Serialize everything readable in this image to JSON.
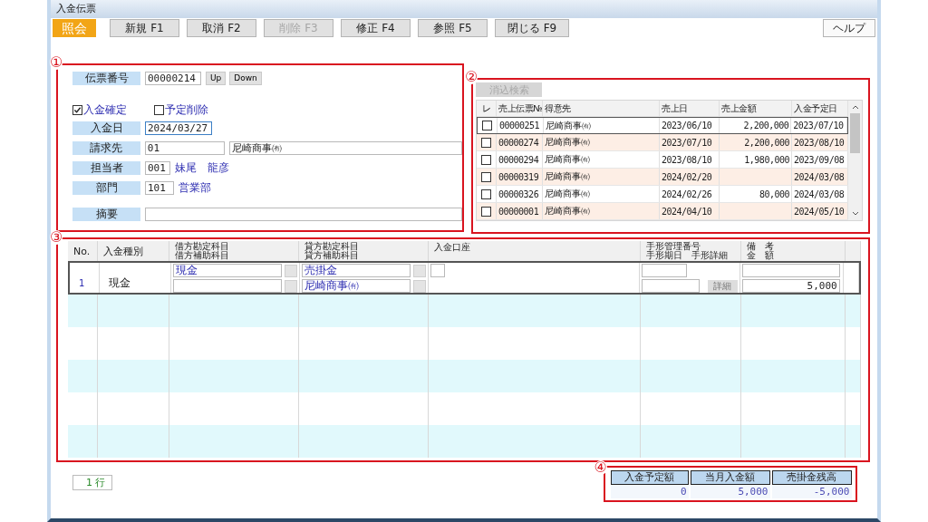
{
  "window": {
    "title": "入金伝票"
  },
  "mode_badge": "照会",
  "toolbar": [
    {
      "label": "新規 F1",
      "disabled": false
    },
    {
      "label": "取消 F2",
      "disabled": false
    },
    {
      "label": "削除 F3",
      "disabled": true
    },
    {
      "label": "修正 F4",
      "disabled": false
    },
    {
      "label": "参照 F5",
      "disabled": false
    },
    {
      "label": "閉じる F9",
      "disabled": false
    }
  ],
  "help_button": "ヘルプ",
  "header_form": {
    "marker": "①",
    "slip_no": {
      "label": "伝票番号",
      "value": "00000214"
    },
    "nav_buttons": [
      "Up",
      "Down"
    ],
    "checks": [
      {
        "label": "入金確定",
        "checked": true
      },
      {
        "label": "予定削除",
        "checked": false
      }
    ],
    "date": {
      "label": "入金日",
      "value": "2024/03/27"
    },
    "billing": {
      "label": "請求先",
      "code": "01",
      "name": "尼崎商事㈲"
    },
    "staff": {
      "label": "担当者",
      "code": "001",
      "name": "妹尾　龍彦"
    },
    "dept": {
      "label": "部門",
      "code": "101",
      "name": "営業部"
    },
    "memo": {
      "label": "摘要"
    }
  },
  "sales_list": {
    "marker": "②",
    "search_button": {
      "label": "消込検索",
      "disabled": true
    },
    "check_header": "レ",
    "columns": [
      "売上伝票№",
      "得意先",
      "売上日",
      "売上金額",
      "入金予定日"
    ],
    "rows": [
      {
        "checked": false,
        "selected": true,
        "cells": [
          "00000251",
          "尼崎商事㈲",
          "2023/06/10",
          "2,200,000",
          "2023/07/10"
        ]
      },
      {
        "checked": false,
        "selected": false,
        "cells": [
          "00000274",
          "尼崎商事㈲",
          "2023/07/10",
          "2,200,000",
          "2023/08/10"
        ]
      },
      {
        "checked": false,
        "selected": false,
        "cells": [
          "00000294",
          "尼崎商事㈲",
          "2023/08/10",
          "1,980,000",
          "2023/09/08"
        ]
      },
      {
        "checked": false,
        "selected": false,
        "cells": [
          "00000319",
          "尼崎商事㈲",
          "2024/02/20",
          "",
          "2024/03/08"
        ]
      },
      {
        "checked": false,
        "selected": false,
        "cells": [
          "00000326",
          "尼崎商事㈲",
          "2024/02/26",
          "80,000",
          "2024/03/08"
        ]
      },
      {
        "checked": false,
        "selected": false,
        "cells": [
          "00000001",
          "尼崎商事㈲",
          "2024/04/10",
          "",
          "2024/05/10"
        ]
      }
    ]
  },
  "detail": {
    "marker": "③",
    "columns": [
      {
        "lines": [
          "No."
        ]
      },
      {
        "lines": [
          "入金種別"
        ]
      },
      {
        "lines": [
          "借方勘定科目",
          "借方補助科目"
        ]
      },
      {
        "lines": [
          "貸方勘定科目",
          "貸方補助科目"
        ]
      },
      {
        "lines": [
          "入金口座"
        ]
      },
      {
        "lines": [
          "手形管理番号",
          "手形期日　手形詳細"
        ]
      },
      {
        "lines": [
          "備　考",
          "金　額"
        ]
      }
    ],
    "rows": [
      {
        "no": "1",
        "type": "現金",
        "debit": "現金",
        "credit": "売掛金",
        "credit_sub": "尼崎商事㈲",
        "detail_button": "詳細",
        "amount": "5,000"
      }
    ]
  },
  "row_count": "1 行",
  "totals": {
    "marker": "④",
    "columns": [
      "入金予定額",
      "当月入金額",
      "売掛金残高"
    ],
    "values": [
      "0",
      "5,000",
      "-5,000"
    ]
  }
}
